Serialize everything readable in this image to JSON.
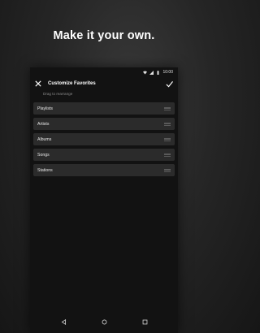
{
  "headline": "Make it your own.",
  "status": {
    "time": "10:00",
    "icons": [
      "wifi-icon",
      "signal-icon",
      "battery-icon"
    ]
  },
  "appbar": {
    "title": "Customize Favorites",
    "close_icon": "close-icon",
    "confirm_icon": "check-icon"
  },
  "subtitle": "Drag to rearrange",
  "favorites": [
    {
      "label": "Playlists"
    },
    {
      "label": "Artists"
    },
    {
      "label": "Albums"
    },
    {
      "label": "Songs"
    },
    {
      "label": "Stations"
    }
  ],
  "navbar": {
    "icons": [
      "back-icon",
      "home-icon",
      "recents-icon"
    ]
  },
  "colors": {
    "background": "#121212",
    "row": "#2b2b2b",
    "text": "#e8e8e8",
    "muted": "#8a8a8a"
  }
}
